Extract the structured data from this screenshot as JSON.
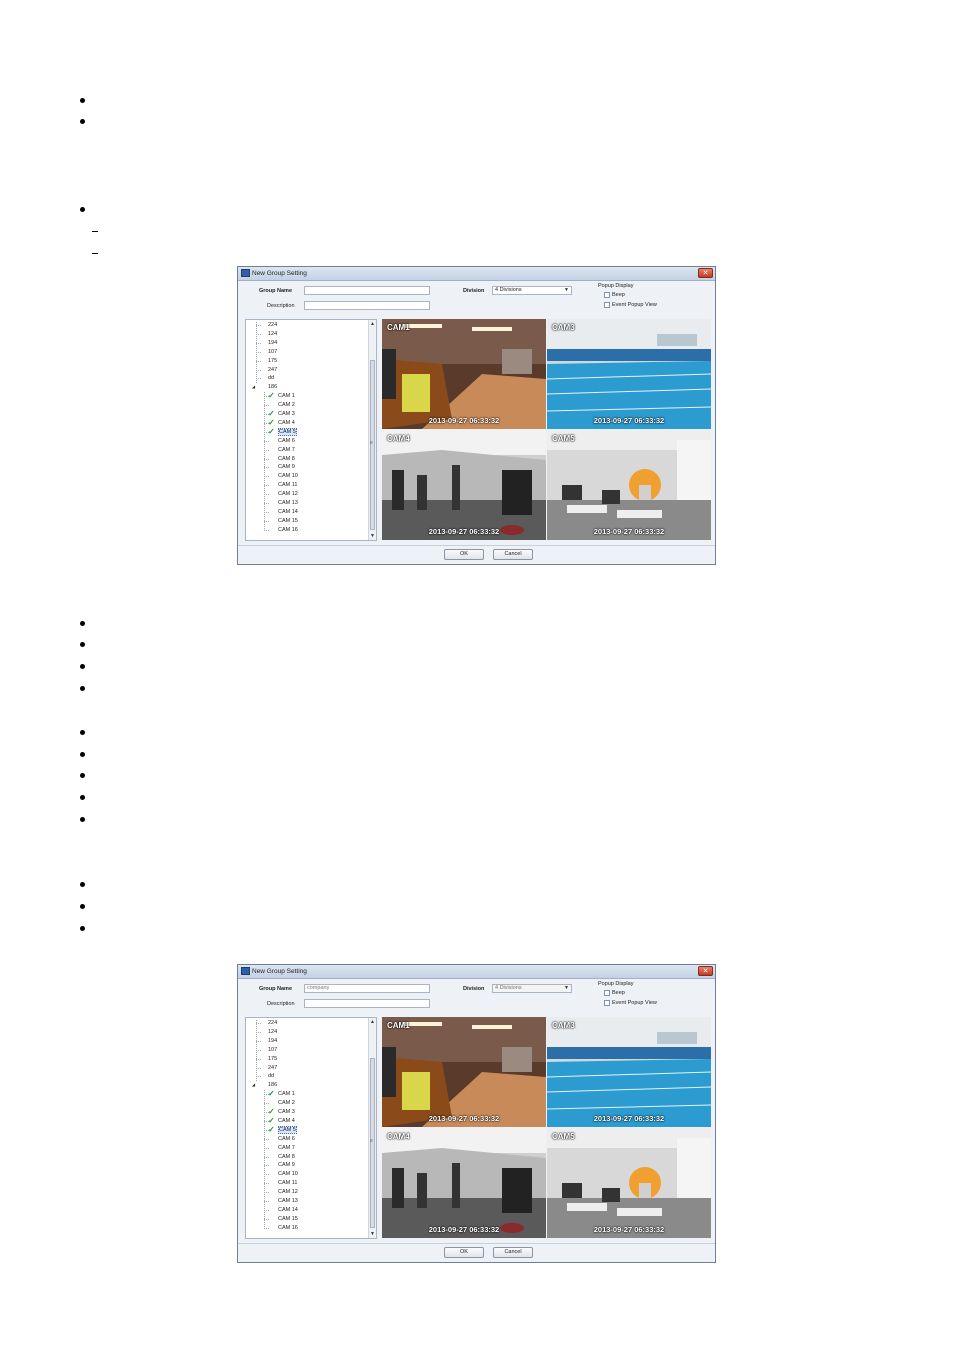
{
  "dialogs": [
    {
      "title": "New Group Setting",
      "group_name_label": "Group Name",
      "group_name_value": "",
      "description_label": "Description",
      "description_value": "",
      "division_label": "Division",
      "division_value": "4 Divisions",
      "popup_display_label": "Popup Display",
      "beep_label": "Beep",
      "event_popup_label": "Event Popup View",
      "ok_label": "OK",
      "cancel_label": "Cancel",
      "division_enabled": true
    },
    {
      "title": "New Group Setting",
      "group_name_label": "Group Name",
      "group_name_value": "company",
      "description_label": "Description",
      "description_value": "",
      "division_label": "Division",
      "division_value": "4 Divisions",
      "popup_display_label": "Popup Display",
      "beep_label": "Beep",
      "event_popup_label": "Event Popup View",
      "ok_label": "OK",
      "cancel_label": "Cancel",
      "division_enabled": false
    }
  ],
  "tree": {
    "roots": [
      "224",
      "124",
      "194",
      "107",
      "175",
      "247",
      "dd"
    ],
    "expanded_node": "186",
    "expand_glyph": "◢",
    "cameras": [
      {
        "label": "CAM 1",
        "checked": true
      },
      {
        "label": "CAM 2",
        "checked": false
      },
      {
        "label": "CAM 3",
        "checked": true
      },
      {
        "label": "CAM 4",
        "checked": true
      },
      {
        "label": "CAM 5",
        "checked": true,
        "selected": true
      },
      {
        "label": "CAM 6",
        "checked": false
      },
      {
        "label": "CAM 7",
        "checked": false
      },
      {
        "label": "CAM 8",
        "checked": false
      },
      {
        "label": "CAM 9",
        "checked": false
      },
      {
        "label": "CAM 10",
        "checked": false
      },
      {
        "label": "CAM 11",
        "checked": false
      },
      {
        "label": "CAM 12",
        "checked": false
      },
      {
        "label": "CAM 13",
        "checked": false
      },
      {
        "label": "CAM 14",
        "checked": false
      },
      {
        "label": "CAM 15",
        "checked": false
      },
      {
        "label": "CAM 16",
        "checked": false
      }
    ]
  },
  "views": [
    {
      "label": "CAM1",
      "time": "2013-09-27  06:33:32",
      "scene": "lobby"
    },
    {
      "label": "CAM3",
      "time": "2013-09-27  06:33:32",
      "scene": "pool"
    },
    {
      "label": "CAM4",
      "time": "2013-09-27  06:33:32",
      "scene": "gym"
    },
    {
      "label": "CAM5",
      "time": "2013-09-27  06:33:32",
      "scene": "office"
    }
  ],
  "glyphs": {
    "close": "✕",
    "check": "✓",
    "dropdown": "▼",
    "scroll_up": "▲",
    "scroll_down": "▼",
    "grip": "≡"
  },
  "colors": {
    "check_green": "#1c9a1c",
    "title_bar": "#c3d1e3",
    "close_red": "#c23b22"
  }
}
